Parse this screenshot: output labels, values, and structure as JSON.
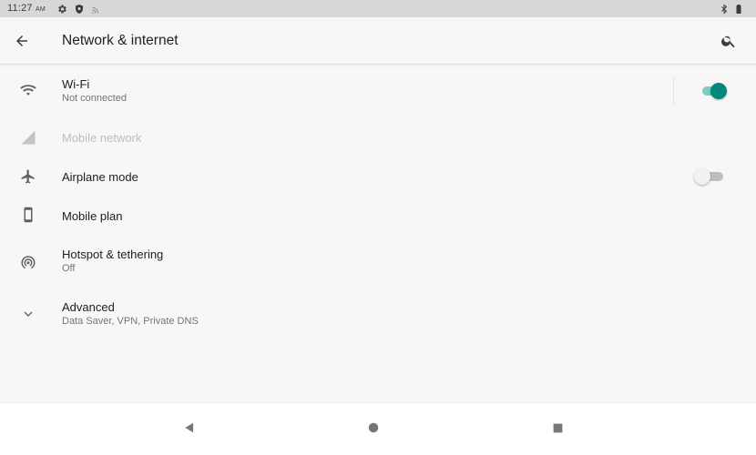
{
  "status_bar": {
    "time": "11:27",
    "ampm": "AM",
    "icons": [
      "settings-icon",
      "shield-icon",
      "cast-icon",
      "bluetooth-icon",
      "battery-icon"
    ]
  },
  "toolbar": {
    "title": "Network & internet",
    "back_icon": "arrow-back-icon",
    "search_icon": "search-icon"
  },
  "items": [
    {
      "icon": "wifi-icon",
      "title": "Wi-Fi",
      "summary": "Not connected",
      "toggle": true,
      "enabled": true
    },
    {
      "icon": "signal-icon",
      "title": "Mobile network",
      "enabled": false
    },
    {
      "icon": "airplane-icon",
      "title": "Airplane mode",
      "toggle": false,
      "enabled": true
    },
    {
      "icon": "phone-icon",
      "title": "Mobile plan",
      "enabled": true
    },
    {
      "icon": "hotspot-icon",
      "title": "Hotspot & tethering",
      "summary": "Off",
      "enabled": true
    },
    {
      "icon": "expand-icon",
      "title": "Advanced",
      "summary": "Data Saver, VPN, Private DNS",
      "enabled": true
    }
  ],
  "colors": {
    "accent": "#00897b",
    "accent_track": "#80cbc4",
    "switch_off_thumb": "#f1f1f1",
    "switch_off_track": "#bdbdbd"
  },
  "nav_bar": {
    "buttons": [
      "back-triangle-icon",
      "home-circle-icon",
      "recents-square-icon"
    ]
  }
}
